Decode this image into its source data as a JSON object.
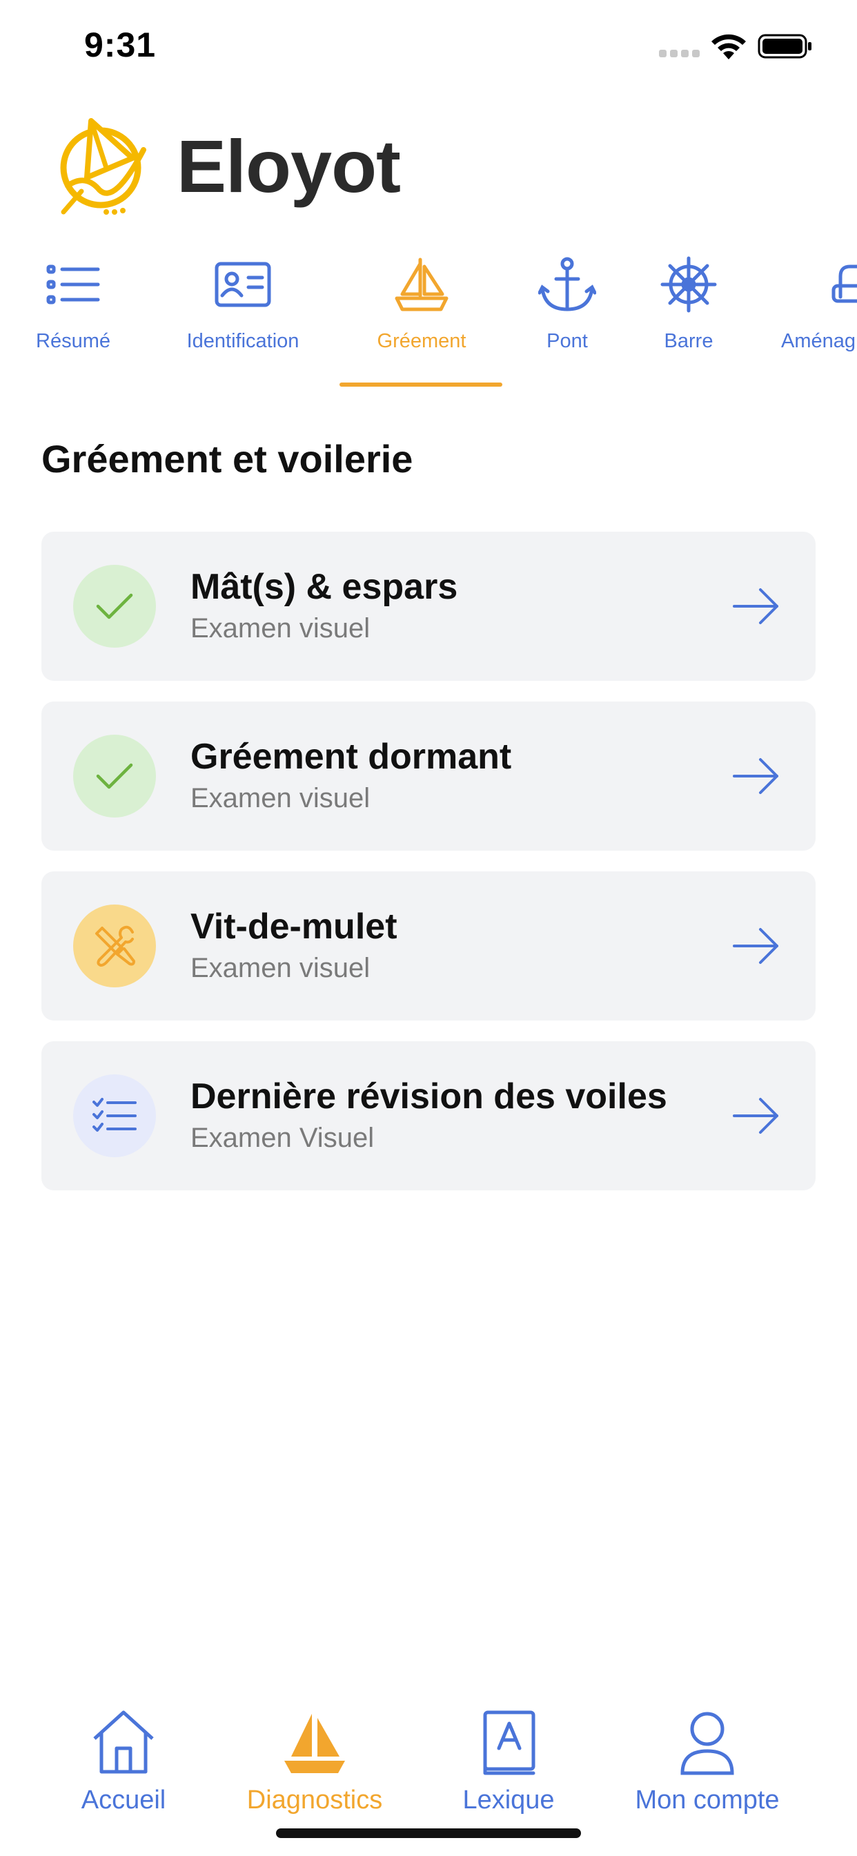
{
  "status_bar": {
    "time": "9:31"
  },
  "brand": {
    "name": "Eloyot"
  },
  "tabs": [
    {
      "label": "Résumé",
      "icon": "list-icon",
      "active": false
    },
    {
      "label": "Identification",
      "icon": "id-card-icon",
      "active": false
    },
    {
      "label": "Gréement",
      "icon": "sailboat-icon",
      "active": true
    },
    {
      "label": "Pont",
      "icon": "anchor-icon",
      "active": false
    },
    {
      "label": "Barre",
      "icon": "ship-wheel-icon",
      "active": false
    },
    {
      "label": "Aménag",
      "icon": "seat-icon",
      "active": false
    }
  ],
  "section": {
    "title": "Gréement et voilerie"
  },
  "items": [
    {
      "title": "Mât(s) & espars",
      "subtitle": "Examen visuel",
      "status_icon": "check-icon"
    },
    {
      "title": "Gréement dormant",
      "subtitle": "Examen visuel",
      "status_icon": "check-icon"
    },
    {
      "title": "Vit-de-mulet",
      "subtitle": "Examen visuel",
      "status_icon": "tools-icon"
    },
    {
      "title": "Dernière révision des voiles",
      "subtitle": "Examen Visuel",
      "status_icon": "checklist-icon"
    }
  ],
  "bottom_nav": [
    {
      "label": "Accueil",
      "icon": "home-icon",
      "active": false
    },
    {
      "label": "Diagnostics",
      "icon": "sailboat-filled-icon",
      "active": true
    },
    {
      "label": "Lexique",
      "icon": "book-icon",
      "active": false
    },
    {
      "label": "Mon compte",
      "icon": "user-icon",
      "active": false
    }
  ],
  "colors": {
    "accent": "#f2a62e",
    "primary": "#4a74d9",
    "done_bg": "#d9f0d2",
    "done_fg": "#6db33f",
    "fix_bg": "#f9d98b",
    "todo_bg": "#e6eafb",
    "card_bg": "#f2f3f5"
  }
}
